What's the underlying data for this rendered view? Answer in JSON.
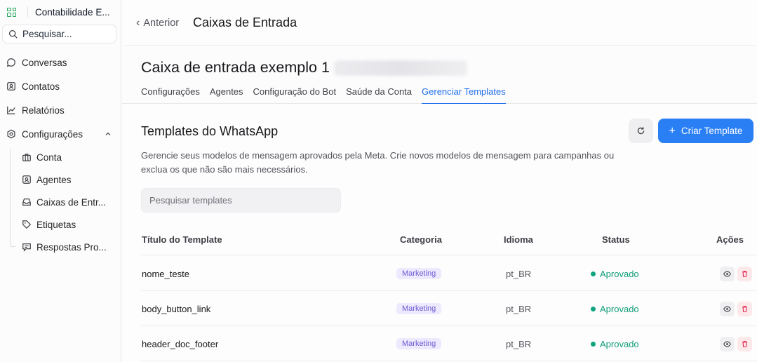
{
  "sidebar": {
    "brand": "Contabilidade E...",
    "search_label": "Pesquisar...",
    "items": [
      {
        "label": "Conversas",
        "icon": "chat-bubble-icon"
      },
      {
        "label": "Contatos",
        "icon": "contact-card-icon"
      },
      {
        "label": "Relatórios",
        "icon": "line-chart-icon"
      },
      {
        "label": "Configurações",
        "icon": "gear-icon"
      }
    ],
    "subitems": [
      {
        "label": "Conta",
        "icon": "briefcase-icon"
      },
      {
        "label": "Agentes",
        "icon": "agent-card-icon"
      },
      {
        "label": "Caixas de Entr...",
        "icon": "inbox-icon"
      },
      {
        "label": "Etiquetas",
        "icon": "tag-icon"
      },
      {
        "label": "Respostas Pro...",
        "icon": "canned-response-icon"
      }
    ]
  },
  "header": {
    "back_label": "Anterior",
    "title": "Caixas de Entrada"
  },
  "inbox": {
    "name": "Caixa de entrada exemplo 1",
    "tabs": [
      "Configurações",
      "Agentes",
      "Configuração do Bot",
      "Saúde da Conta",
      "Gerenciar Templates"
    ],
    "active_tab": "Gerenciar Templates"
  },
  "templates": {
    "title": "Templates do WhatsApp",
    "create_label": "Criar Template",
    "description": "Gerencie seus modelos de mensagem aprovados pela Meta. Crie novos modelos de mensagem para campanhas ou exclua os que não são mais necessários.",
    "search_placeholder": "Pesquisar templates",
    "columns": [
      "Título do Template",
      "Categoria",
      "Idioma",
      "Status",
      "Ações"
    ],
    "rows": [
      {
        "name": "nome_teste",
        "category": "Marketing",
        "language": "pt_BR",
        "status": "Aprovado"
      },
      {
        "name": "body_button_link",
        "category": "Marketing",
        "language": "pt_BR",
        "status": "Aprovado"
      },
      {
        "name": "header_doc_footer",
        "category": "Marketing",
        "language": "pt_BR",
        "status": "Aprovado"
      }
    ]
  },
  "colors": {
    "accent": "#2a7ff5",
    "brand": "#22a75a",
    "status_approved": "#0f9d77",
    "badge_bg": "#ede9fe",
    "badge_text": "#6d5bd0",
    "delete_bg": "#fde8ea"
  }
}
